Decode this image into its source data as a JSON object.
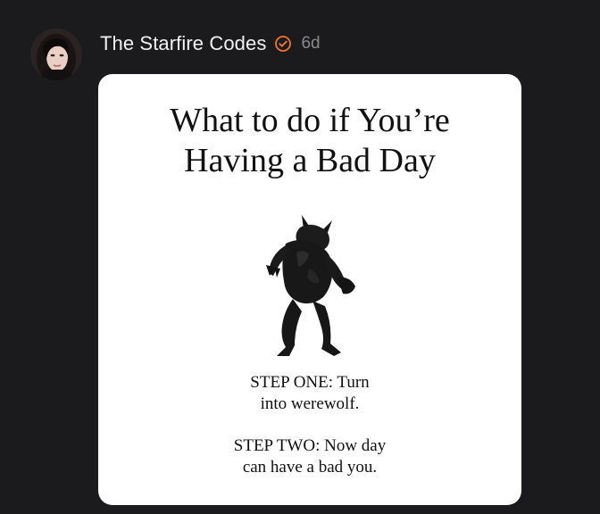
{
  "post": {
    "author": "The Starfire Codes",
    "timestamp": "6d",
    "verified": true,
    "accent_color": "#f5732e"
  },
  "meme": {
    "title_line1": "What to do if You’re",
    "title_line2": "Having a Bad Day",
    "step_one_line1": "STEP ONE: Turn",
    "step_one_line2": "into werewolf.",
    "step_two_line1": "STEP TWO: Now day",
    "step_two_line2": "can have a bad you."
  },
  "icons": {
    "verified": "verified-badge-icon",
    "figure": "werewolf-illustration"
  }
}
